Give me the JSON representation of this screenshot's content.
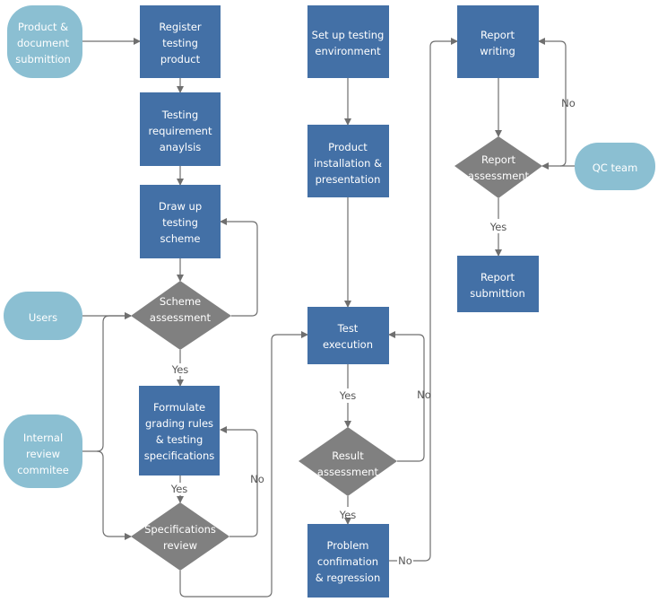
{
  "colors": {
    "process": "#4370a6",
    "decision": "#808080",
    "terminal": "#8bbfd2",
    "connector": "#6f6f6f",
    "edge_label": "#555555",
    "node_text": "#ffffff"
  },
  "nodes": {
    "product_submission": {
      "type": "terminal",
      "lines": [
        "Product &",
        "document",
        "submittion"
      ]
    },
    "register": {
      "type": "process",
      "lines": [
        "Register",
        "testing",
        "product"
      ]
    },
    "requirement": {
      "type": "process",
      "lines": [
        "Testing",
        "requirement",
        "anaylsis"
      ]
    },
    "scheme": {
      "type": "process",
      "lines": [
        "Draw up",
        "testing",
        "scheme"
      ]
    },
    "scheme_assessment": {
      "type": "decision",
      "lines": [
        "Scheme",
        "assessment"
      ]
    },
    "users": {
      "type": "terminal",
      "lines": [
        "Users"
      ]
    },
    "internal_review": {
      "type": "terminal",
      "lines": [
        "Internal",
        "review",
        "commitee"
      ]
    },
    "grading_rules": {
      "type": "process",
      "lines": [
        "Formulate",
        "grading rules",
        "& testing",
        "specifications"
      ]
    },
    "spec_review": {
      "type": "decision",
      "lines": [
        "Specifications",
        "review"
      ]
    },
    "setup_env": {
      "type": "process",
      "lines": [
        "Set up testing",
        "environment"
      ]
    },
    "installation": {
      "type": "process",
      "lines": [
        "Product",
        "installation &",
        "presentation"
      ]
    },
    "test_execution": {
      "type": "process",
      "lines": [
        "Test",
        "execution"
      ]
    },
    "result_assessment": {
      "type": "decision",
      "lines": [
        "Result",
        "assessment"
      ]
    },
    "problem": {
      "type": "process",
      "lines": [
        "Problem",
        "confimation",
        "& regression"
      ]
    },
    "report_writing": {
      "type": "process",
      "lines": [
        "Report",
        "writing"
      ]
    },
    "report_assessment": {
      "type": "decision",
      "lines": [
        "Report",
        "assessment"
      ]
    },
    "qc_team": {
      "type": "terminal",
      "lines": [
        "QC team"
      ]
    },
    "report_submission": {
      "type": "process",
      "lines": [
        "Report",
        "submittion"
      ]
    }
  },
  "edge_labels": {
    "scheme_yes": "Yes",
    "grading_yes": "Yes",
    "spec_no": "No",
    "exec_yes": "Yes",
    "result_no": "No",
    "result_yes": "Yes",
    "problem_no": "No",
    "report_no": "No",
    "report_yes": "Yes"
  }
}
